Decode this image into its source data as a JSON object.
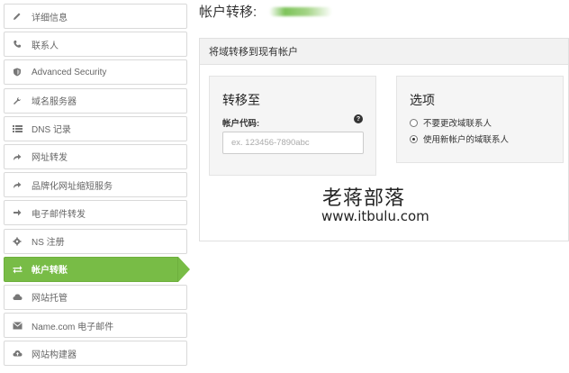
{
  "sidebar": {
    "items": [
      {
        "label": "详细信息",
        "icon": "pencil-icon"
      },
      {
        "label": "联系人",
        "icon": "phone-icon"
      },
      {
        "label": "Advanced Security",
        "icon": "shield-icon"
      },
      {
        "label": "域名服务器",
        "icon": "wrench-icon"
      },
      {
        "label": "DNS 记录",
        "icon": "list-icon"
      },
      {
        "label": "网址转发",
        "icon": "forward-arrow-icon"
      },
      {
        "label": "品牌化网址缩短服务",
        "icon": "share-arrow-icon"
      },
      {
        "label": "电子邮件转发",
        "icon": "arrow-right-icon"
      },
      {
        "label": "NS 注册",
        "icon": "gear-icon"
      },
      {
        "label": "帐户转账",
        "icon": "exchange-icon",
        "active": true
      },
      {
        "label": "网站托管",
        "icon": "cloud-icon"
      },
      {
        "label": "Name.com 电子邮件",
        "icon": "envelope-icon"
      },
      {
        "label": "网站构建器",
        "icon": "cloud-upload-icon"
      }
    ],
    "active_color": "#78bc46"
  },
  "header": {
    "title": "帐户转移:"
  },
  "panel": {
    "header": "将域转移到现有帐户",
    "transfer": {
      "title": "转移至",
      "field_label": "帐户代码:",
      "help": "?",
      "placeholder": "ex. 123456-7890abc",
      "value": ""
    },
    "options": {
      "title": "选项",
      "radios": [
        {
          "label": "不要更改域联系人",
          "checked": false
        },
        {
          "label": "使用新帐户的域联系人",
          "checked": true
        }
      ]
    }
  },
  "watermark": {
    "title": "老蒋部落",
    "url": "www.itbulu.com"
  }
}
